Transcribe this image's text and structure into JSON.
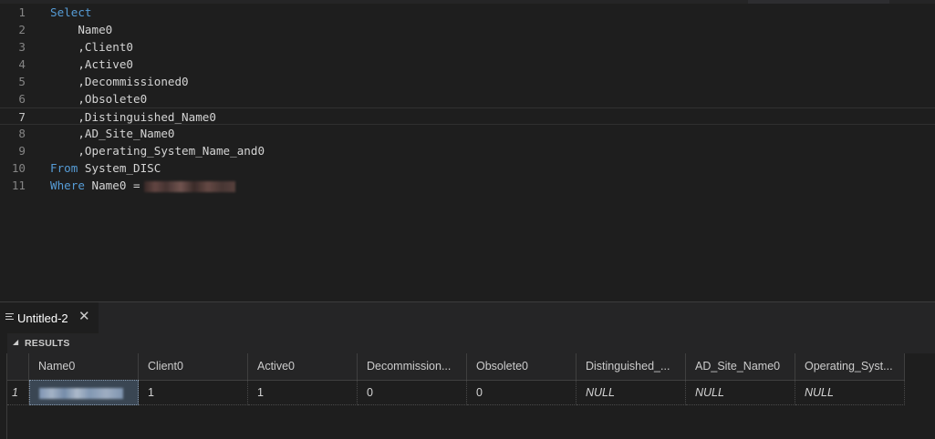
{
  "editor": {
    "lines": [
      {
        "num": "1",
        "kw": "Select",
        "rest": ""
      },
      {
        "num": "2",
        "kw": "",
        "rest": "    Name0"
      },
      {
        "num": "3",
        "kw": "",
        "rest": "    ,Client0"
      },
      {
        "num": "4",
        "kw": "",
        "rest": "    ,Active0"
      },
      {
        "num": "5",
        "kw": "",
        "rest": "    ,Decommissioned0"
      },
      {
        "num": "6",
        "kw": "",
        "rest": "    ,Obsolete0"
      },
      {
        "num": "7",
        "kw": "",
        "rest": "    ,Distinguished_Name0"
      },
      {
        "num": "8",
        "kw": "",
        "rest": "    ,AD_Site_Name0"
      },
      {
        "num": "9",
        "kw": "",
        "rest": "    ,Operating_System_Name_and0"
      },
      {
        "num": "10",
        "kw": "From",
        "rest": " System_DISC"
      },
      {
        "num": "11",
        "kw": "Where",
        "rest": " Name0 ="
      }
    ],
    "current_line": 7
  },
  "tab": {
    "label": "Untitled-2",
    "close_glyph": "✕"
  },
  "results": {
    "title": "RESULTS",
    "caret": "◢",
    "columns": [
      "Name0",
      "Client0",
      "Active0",
      "Decommission...",
      "Obsolete0",
      "Distinguished_...",
      "AD_Site_Name0",
      "Operating_Syst..."
    ],
    "rows": [
      {
        "num": "1",
        "cells": [
          "",
          "1",
          "1",
          "0",
          "0",
          "NULL",
          "NULL",
          "NULL"
        ]
      }
    ]
  },
  "colors": {
    "background": "#1e1e1e",
    "keyword": "#569cd6",
    "selection": "#3a4653"
  }
}
